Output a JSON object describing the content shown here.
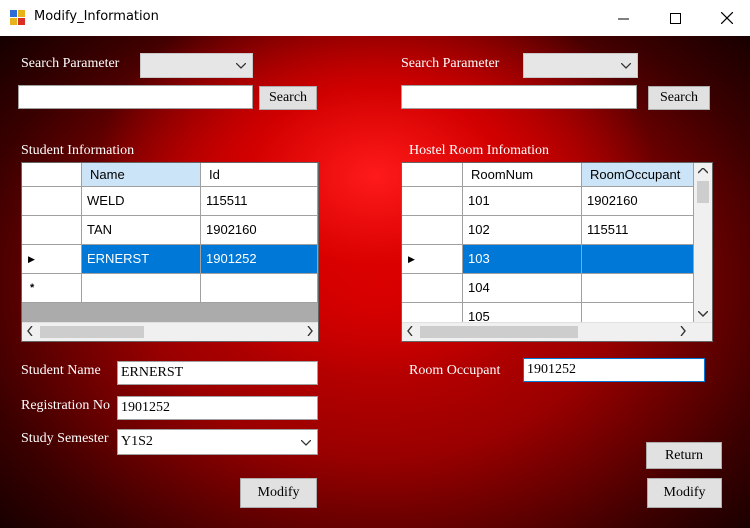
{
  "window": {
    "title": "Modify_Information",
    "icon": "app-form-icon",
    "controls": [
      "minimize-icon",
      "maximize-icon",
      "close-icon"
    ]
  },
  "left": {
    "search": {
      "label": "Search Parameter",
      "combo_value": "",
      "input_value": "",
      "button": "Search"
    },
    "grid_label": "Student Information",
    "grid": {
      "columns": [
        "Name",
        "Id"
      ],
      "rows": [
        {
          "name": "WELD",
          "id": "115511",
          "selected": false
        },
        {
          "name": "TAN",
          "id": "1902160",
          "selected": false
        },
        {
          "name": "ERNERST",
          "id": "1901252",
          "selected": true
        }
      ],
      "new_row_marker": "*",
      "current_row_marker": "▶"
    },
    "fields": {
      "student_name_label": "Student Name",
      "student_name_value": "ERNERST",
      "reg_no_label": "Registration No",
      "reg_no_value": "1901252",
      "semester_label": "Study Semester",
      "semester_value": "Y1S2"
    },
    "modify_button": "Modify"
  },
  "right": {
    "search": {
      "label": "Search Parameter",
      "combo_value": "",
      "input_value": "",
      "button": "Search"
    },
    "grid_label": "Hostel Room Infomation",
    "grid": {
      "columns": [
        "RoomNum",
        "RoomOccupant"
      ],
      "rows": [
        {
          "room": "101",
          "occupant": "1902160",
          "selected": false
        },
        {
          "room": "102",
          "occupant": "115511",
          "selected": false
        },
        {
          "room": "103",
          "occupant": "",
          "selected": true
        },
        {
          "room": "104",
          "occupant": "",
          "selected": false
        },
        {
          "room": "105",
          "occupant": "",
          "selected": false
        }
      ],
      "current_row_marker": "▶"
    },
    "fields": {
      "room_occupant_label": "Room Occupant",
      "room_occupant_value": "1901252"
    },
    "return_button": "Return",
    "modify_button": "Modify"
  },
  "colors": {
    "background_red": "#d40000",
    "selection_blue": "#0078d7",
    "header_selected": "#cce4f7"
  }
}
